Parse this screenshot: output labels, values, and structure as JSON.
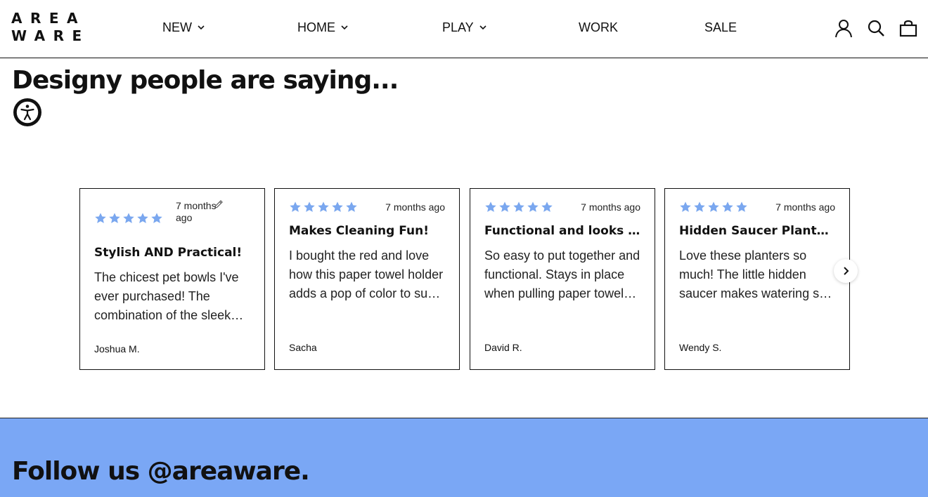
{
  "brand": {
    "logo_line1": "AREA",
    "logo_line2": "WARE"
  },
  "nav": [
    {
      "label": "NEW",
      "dropdown": true
    },
    {
      "label": "HOME",
      "dropdown": true
    },
    {
      "label": "PLAY",
      "dropdown": true
    },
    {
      "label": "WORK",
      "dropdown": false
    },
    {
      "label": "SALE",
      "dropdown": false
    }
  ],
  "header_icons": [
    "account-icon",
    "search-icon",
    "cart-icon"
  ],
  "reviews": {
    "title": "Designy people are saying...",
    "star_color": "#7aa7ef",
    "items": [
      {
        "rating": 5,
        "date": "7 months ago",
        "title": "Stylish AND Practical!",
        "body": "The chicest pet bowls I've ever purchased! The combination of the sleek design and practical use is perfect.",
        "author": "Joshua M."
      },
      {
        "rating": 5,
        "date": "7 months ago",
        "title": "Makes Cleaning Fun!",
        "body": "I bought the red and love how this paper towel holder adds a pop of color to such a mundane item.",
        "author": "Sacha"
      },
      {
        "rating": 5,
        "date": "7 months ago",
        "title": "Functional and looks great",
        "body": "So easy to put together and functional. Stays in place when pulling paper towels off the roll.",
        "author": "David R."
      },
      {
        "rating": 5,
        "date": "7 months ago",
        "title": "Hidden Saucer Planters are great",
        "body": "Love these planters so much! The little hidden saucer makes watering so easy and clean.",
        "author": "Wendy S."
      }
    ]
  },
  "follow": {
    "title": "Follow us @areaware.",
    "bg_color": "#7aa7f5"
  }
}
